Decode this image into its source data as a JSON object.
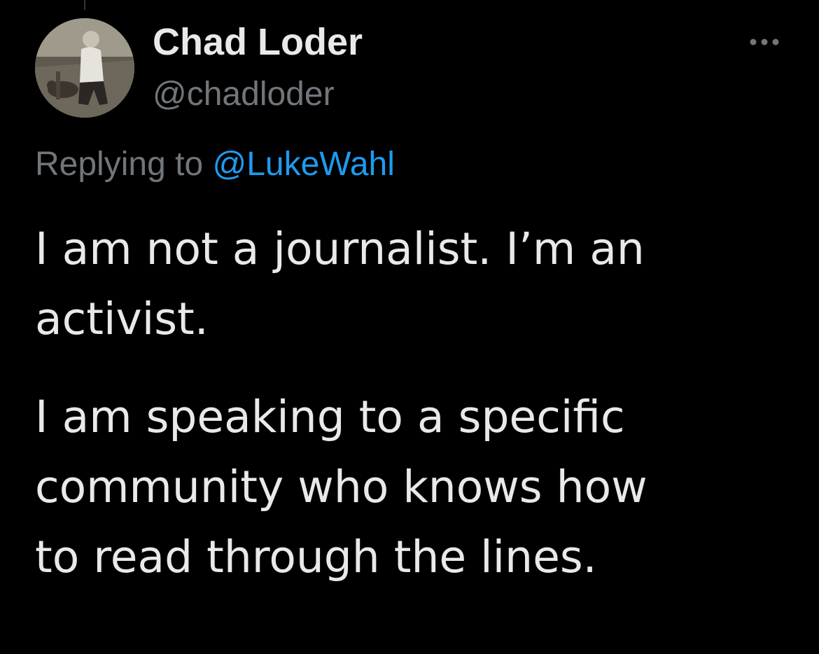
{
  "tweet": {
    "author": {
      "display_name": "Chad Loder",
      "handle": "@chadloder",
      "avatar_icon": "profile-photo-avatar"
    },
    "more_icon": "more-options-icon",
    "reply": {
      "prefix": "Replying to ",
      "mention": "@LukeWahl"
    },
    "paragraphs": [
      "I am not a journalist. I’m an\nactivist.",
      "I am speaking to a specific\ncommunity who knows how\nto read through the lines."
    ]
  },
  "colors": {
    "background": "#000000",
    "primary_text": "#e7e9ea",
    "secondary_text": "#71767b",
    "link": "#1d9bf0"
  }
}
